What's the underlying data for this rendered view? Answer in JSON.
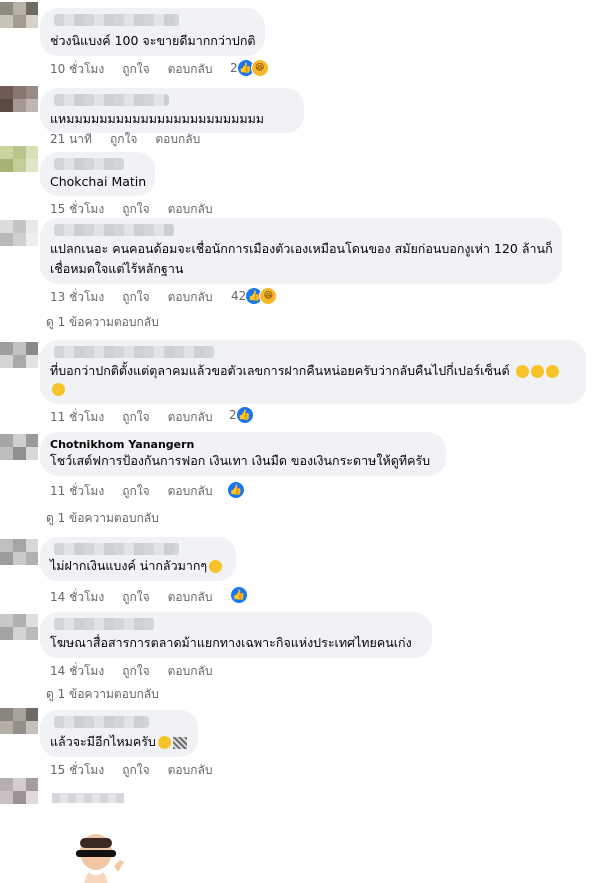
{
  "comments": [
    {
      "text": "ช่วงนิแบงค์ 100 จะขายดีมากกว่าปกติ",
      "time": "10 ชั่วโมง",
      "like": "ถูกใจ",
      "reply": "ตอบกลับ",
      "reactions": "2"
    },
    {
      "text": "แหมมมมมมมมมมมมมมมมมมมมมมมม",
      "time": "21 นาที",
      "like": "ถูกใจ",
      "reply": "ตอบกลับ"
    },
    {
      "name": "Chokchai Matin",
      "time": "15 ชั่วโมง",
      "like": "ถูกใจ",
      "reply": "ตอบกลับ"
    },
    {
      "text1": "แปลกเนอะ คนคอนด้อมจะเชื่อนักการเมืองตัวเองเหมือนโดนของ สมัยก่อนบอกงูเห่า 120 ล้านก็",
      "text2": "เชื่อหมดใจแต่ไร้หลักฐาน",
      "time": "13 ชั่วโมง",
      "like": "ถูกใจ",
      "reply": "ตอบกลับ",
      "reactions": "42",
      "replies": "ดู 1 ข้อความตอบกลับ"
    },
    {
      "text1": "ที่บอกว่าปกติตั้งแต่ตุลาคมแล้วขอตัวเลขการฝากคืนหน่อยครับว่ากลับคืนไปกี่เปอร์เซ็นต์",
      "time": "11 ชั่วโมง",
      "like": "ถูกใจ",
      "reply": "ตอบกลับ",
      "reactions": "2"
    },
    {
      "name": "Chotnikhom Yanangern",
      "text": "โชว์เสต์ฟการป้องกันการฟอก เงินเทา เงินมืด ของเงินกระดาษให้ดูทีครับ",
      "time": "11 ชั่วโมง",
      "like": "ถูกใจ",
      "reply": "ตอบกลับ",
      "replies": "ดู 1 ข้อความตอบกลับ"
    },
    {
      "text": "ไม่ฝากเงินแบงค์ น่ากลัวมากๆ",
      "time": "14 ชั่วโมง",
      "like": "ถูกใจ",
      "reply": "ตอบกลับ"
    },
    {
      "text": "โฆษณาสื่อสารการตลาดม้าแยกทางเฉพาะกิจแห่งประเทศไทยคนเก่ง",
      "time": "14 ชั่วโมง",
      "like": "ถูกใจ",
      "reply": "ตอบกลับ",
      "replies": "ดู 1 ข้อความตอบกลับ"
    },
    {
      "text": "แล้วจะมีอีกไหมครับ",
      "time": "15 ชั่วโมง",
      "like": "ถูกใจ",
      "reply": "ตอบกลับ"
    }
  ],
  "icons": {
    "like": "like-icon",
    "haha": "haha-icon"
  },
  "colors": {
    "bubble": "#f0f2f5",
    "meta": "#65676b",
    "like": "#1877f2"
  }
}
